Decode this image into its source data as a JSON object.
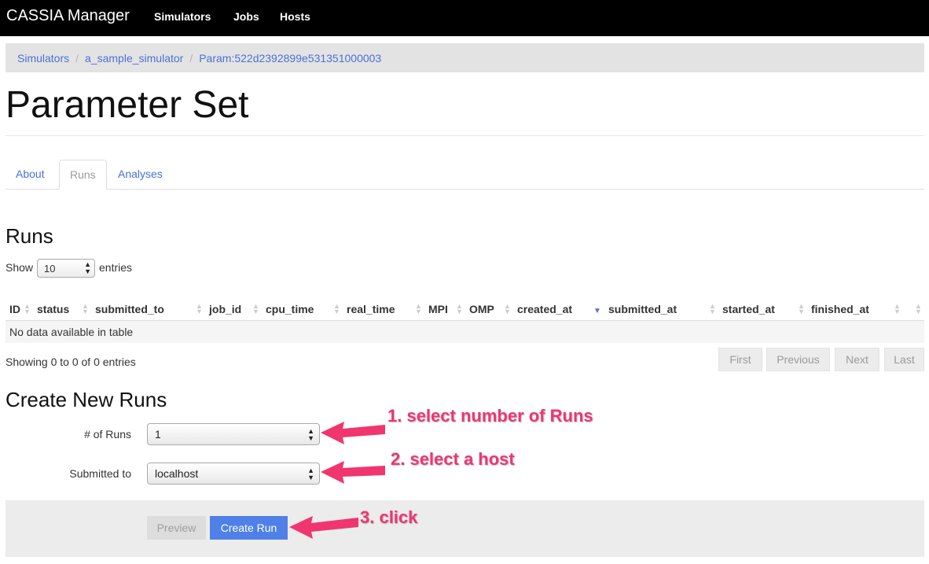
{
  "navbar": {
    "brand": "CASSIA Manager",
    "links": [
      "Simulators",
      "Jobs",
      "Hosts"
    ]
  },
  "breadcrumb": [
    "Simulators",
    "a_sample_simulator",
    "Param:522d2392899e531351000003"
  ],
  "breadcrumb_separator": "/",
  "page_title": "Parameter Set",
  "tabs": [
    {
      "label": "About",
      "active": false
    },
    {
      "label": "Runs",
      "active": true
    },
    {
      "label": "Analyses",
      "active": false
    }
  ],
  "runs": {
    "title": "Runs",
    "show_label": "Show",
    "entries_label": "entries",
    "page_size": "10",
    "columns": [
      "ID",
      "status",
      "submitted_to",
      "job_id",
      "cpu_time",
      "real_time",
      "MPI",
      "OMP",
      "created_at",
      "submitted_at",
      "started_at",
      "finished_at"
    ],
    "empty_message": "No data available in table",
    "info": "Showing 0 to 0 of 0 entries",
    "pager": [
      "First",
      "Previous",
      "Next",
      "Last"
    ]
  },
  "create": {
    "title": "Create New Runs",
    "num_runs_label": "# of Runs",
    "num_runs_value": "1",
    "submitted_to_label": "Submitted to",
    "submitted_to_value": "localhost",
    "preview_label": "Preview",
    "create_label": "Create Run"
  },
  "annotations": [
    "1. select number of Runs",
    "2. select a host",
    "3. click"
  ],
  "icons": {
    "select_arrows": "updown-icon",
    "sort": "sort-icon",
    "sort_desc": "sort-desc-icon",
    "annotation_arrow": "arrow-left-icon"
  },
  "colors": {
    "navbar": "#000000",
    "link": "#4a71d6",
    "primary_button": "#4f80e8",
    "annotation": "#f0356f"
  }
}
